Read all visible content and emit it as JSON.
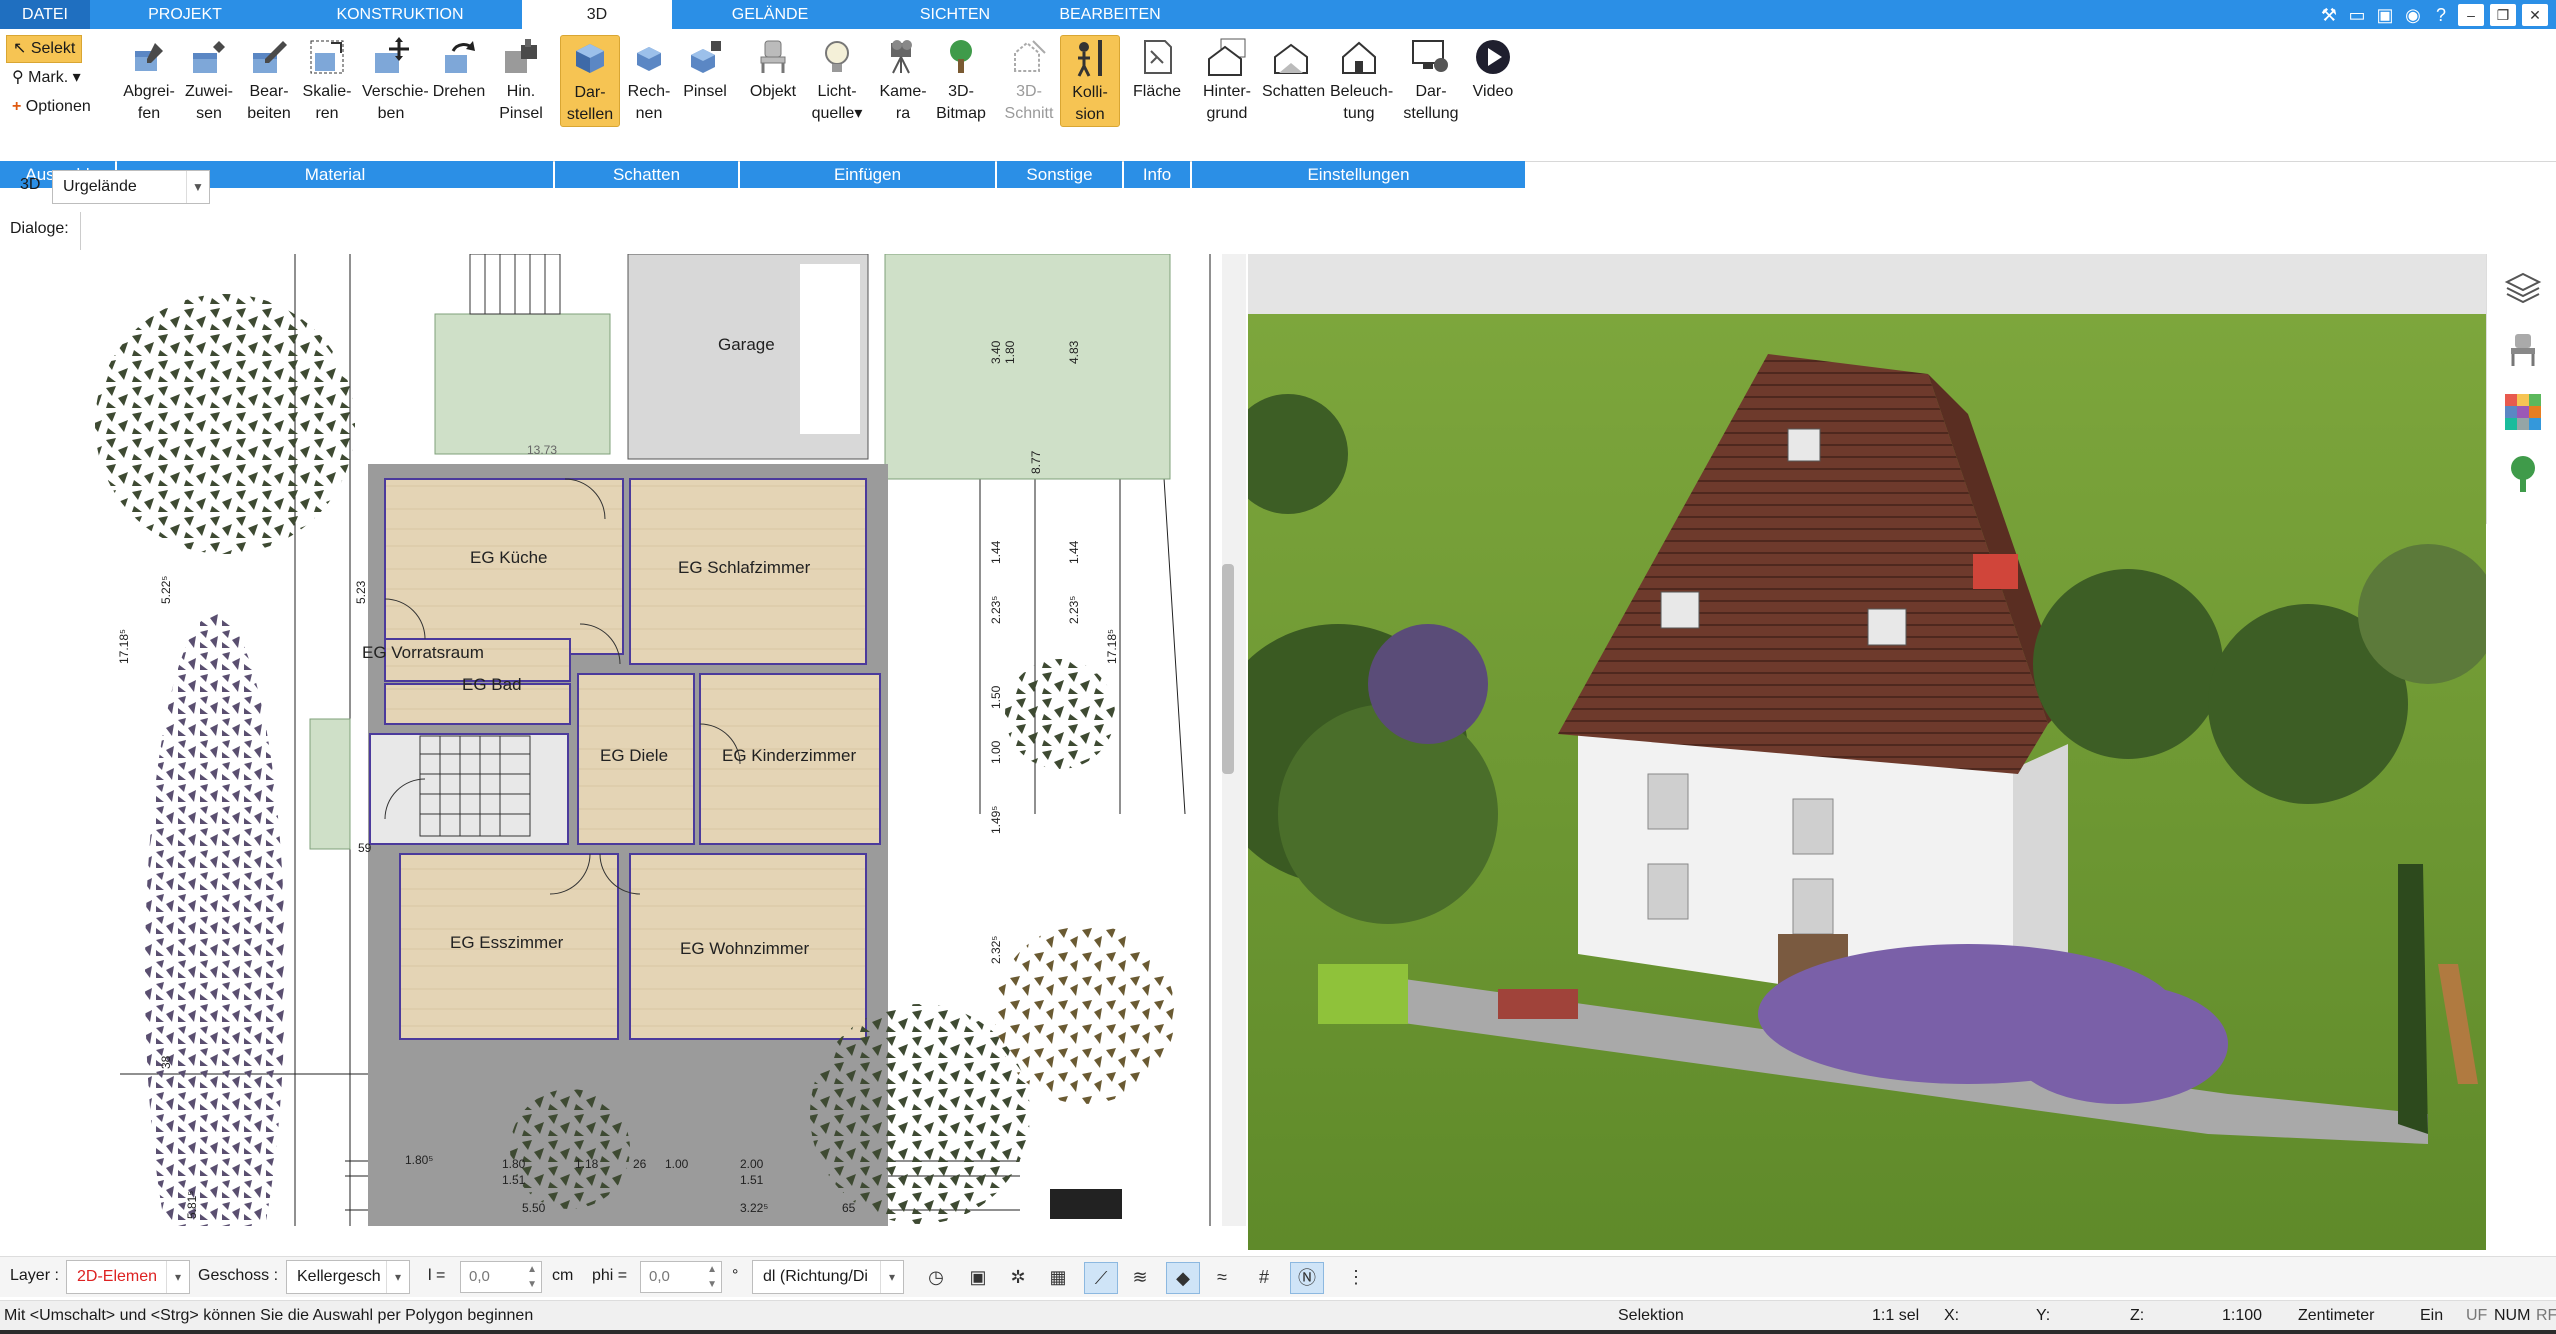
{
  "tabs": [
    {
      "label": "DATEI",
      "active": false
    },
    {
      "label": "PROJEKT",
      "active": false
    },
    {
      "label": "KONSTRUKTION",
      "active": false
    },
    {
      "label": "3D",
      "active": true
    },
    {
      "label": "GELÄNDE",
      "active": false
    },
    {
      "label": "SICHTEN",
      "active": false
    },
    {
      "label": "BEARBEITEN",
      "active": false
    }
  ],
  "selection": {
    "selekt": "Selekt",
    "mark": "Mark.",
    "optionen": "Optionen",
    "group": "Auswahl"
  },
  "material": {
    "group": "Material",
    "buttons": [
      {
        "l1": "Abgrei-",
        "l2": "fen"
      },
      {
        "l1": "Zuwei-",
        "l2": "sen"
      },
      {
        "l1": "Bear-",
        "l2": "beiten"
      },
      {
        "l1": "Skalie-",
        "l2": "ren"
      },
      {
        "l1": "Verschie-",
        "l2": "ben"
      },
      {
        "l1": "Drehen",
        "l2": ""
      },
      {
        "l1": "Hin.",
        "l2": "Pinsel"
      }
    ]
  },
  "schatten": {
    "group": "Schatten",
    "buttons": [
      {
        "l1": "Dar-",
        "l2": "stellen"
      },
      {
        "l1": "Rech-",
        "l2": "nen"
      },
      {
        "l1": "Pinsel",
        "l2": ""
      }
    ]
  },
  "einfuegen": {
    "group": "Einfügen",
    "buttons": [
      {
        "l1": "Objekt",
        "l2": ""
      },
      {
        "l1": "Licht-",
        "l2": "quelle"
      },
      {
        "l1": "Kame-",
        "l2": "ra"
      },
      {
        "l1": "3D-",
        "l2": "Bitmap"
      }
    ]
  },
  "sonstige": {
    "group": "Sonstige",
    "buttons": [
      {
        "l1": "3D-",
        "l2": "Schnitt"
      },
      {
        "l1": "Kolli-",
        "l2": "sion"
      }
    ]
  },
  "info": {
    "group": "Info",
    "buttons": [
      {
        "l1": "Fläche",
        "l2": ""
      }
    ]
  },
  "einstellungen": {
    "group": "Einstellungen",
    "buttons": [
      {
        "l1": "Hinter-",
        "l2": "grund"
      },
      {
        "l1": "Schatten",
        "l2": ""
      },
      {
        "l1": "Beleuch-",
        "l2": "tung"
      },
      {
        "l1": "Dar-",
        "l2": "stellung"
      },
      {
        "l1": "Video",
        "l2": ""
      }
    ]
  },
  "viewrow": {
    "mode": "3D",
    "terrain": "Urgelände",
    "dialoge": "Dialoge:"
  },
  "plan": {
    "rooms": [
      "EG Küche",
      "EG Schlafzimmer",
      "EG Vorratsraum",
      "EG Bad",
      "EG Diele",
      "EG Kinderzimmer",
      "EG Esszimmer",
      "EG Wohnzimmer",
      "Garage"
    ],
    "dims_bottom": [
      "1.80⁵",
      "1.80",
      "1.51",
      "1.18",
      "26",
      "1.00",
      "2.00",
      "1.51",
      "5.50",
      "3.22⁵",
      "65"
    ],
    "dims_left": [
      "17.18⁵",
      "5.22⁵",
      "5.23",
      "38",
      "5.81⁵",
      "59"
    ],
    "dims_right": [
      "3.40",
      "1.80",
      "4.83",
      "8.77",
      "1.44",
      "1.44",
      "2.23⁵",
      "2.23⁵",
      "17.18⁵",
      "1.50",
      "1.00",
      "1.49⁵",
      "2.32⁵",
      "13.73"
    ]
  },
  "options": {
    "layer_label": "Layer :",
    "layer_value": "2D-Elemen",
    "geschoss_label": "Geschoss :",
    "geschoss_value": "Kellergesch",
    "l_label": "l =",
    "l_value": "0,0",
    "unit": "cm",
    "phi_label": "phi =",
    "phi_value": "0,0",
    "deg": "°",
    "dl_value": "dl (Richtung/Di"
  },
  "status": {
    "hint": "Mit <Umschalt> und <Strg> können Sie die Auswahl per Polygon beginnen",
    "mode": "Selektion",
    "sel": "1:1 sel",
    "x": "X:",
    "y": "Y:",
    "z": "Z:",
    "scale": "1:100",
    "unit": "Zentimeter",
    "ein": "Ein",
    "uf": "UF",
    "num": "NUM",
    "rf": "RF"
  },
  "colors": {
    "ribbon_blue": "#2b8fe6",
    "active_yellow": "#f6c453",
    "wall_purple": "#4b3a9c",
    "floor_wood": "#e2d2b4",
    "lawn": "#78a83a",
    "roof": "#6e3a2c"
  }
}
